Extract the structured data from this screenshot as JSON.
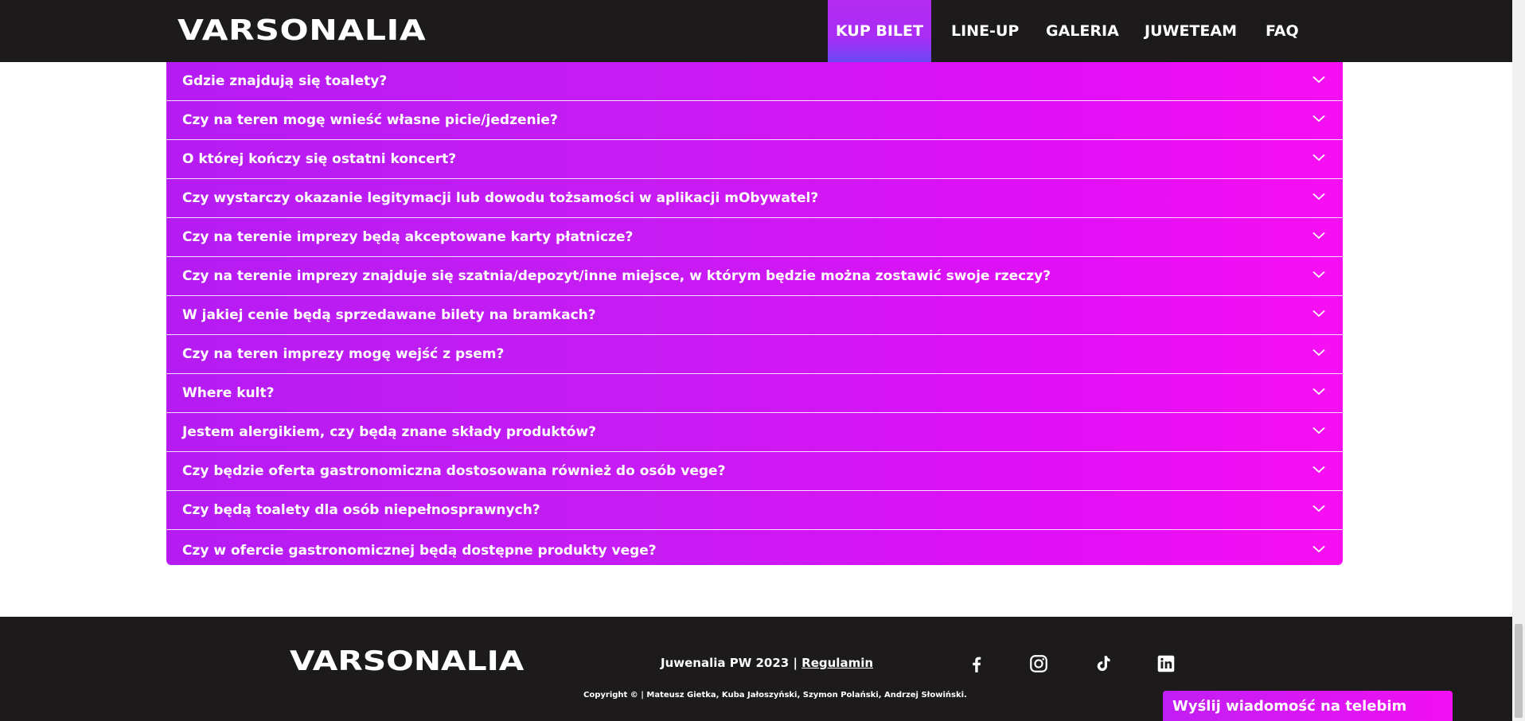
{
  "header": {
    "logo": "VARSONALIA",
    "nav": [
      "KUP BILET",
      "LINE-UP",
      "GALERIA",
      "JUWETEAM",
      "FAQ"
    ]
  },
  "faq": {
    "items": [
      "Gdzie znajdują się toalety?",
      "Czy na teren mogę wnieść własne picie/jedzenie?",
      "O której kończy się ostatni koncert?",
      "Czy wystarczy okazanie legitymacji lub dowodu tożsamości w aplikacji mObywatel?",
      "Czy na terenie imprezy będą akceptowane karty płatnicze?",
      "Czy na terenie imprezy znajduje się szatnia/depozyt/inne miejsce, w którym będzie można zostawić swoje rzeczy?",
      "W jakiej cenie będą sprzedawane bilety na bramkach?",
      "Czy na teren imprezy mogę wejść z psem?",
      "Where kult?",
      "Jestem alergikiem, czy będą znane składy produktów?",
      "Czy będzie oferta gastronomiczna dostosowana również do osób vege?",
      "Czy będą toalety dla osób niepełnosprawnych?",
      "Czy w ofercie gastronomicznej będą dostępne produkty vege?"
    ]
  },
  "footer": {
    "logo": "VARSONALIA",
    "event": "Juwenalia PW 2023 |",
    "regulamin": "Regulamin",
    "copyright": "Copyright © | Mateusz Gietka, Kuba Jałoszyński, Szymon Polański, Andrzej Słowiński.",
    "social": [
      "facebook-icon",
      "instagram-icon",
      "tiktok-icon",
      "linkedin-icon"
    ]
  },
  "telebim": "Wyślij wiadomość na telebim",
  "colors": {
    "header_bg": "#1c1a1b",
    "accent_left": "#b51cf2",
    "accent_right": "#f70ff2"
  }
}
